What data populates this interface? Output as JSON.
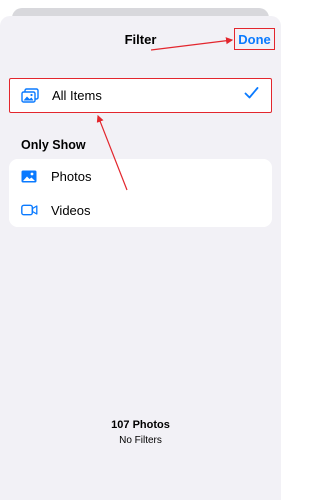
{
  "header": {
    "title": "Filter",
    "done_label": "Done"
  },
  "options": {
    "all_items": {
      "label": "All Items",
      "selected": true
    }
  },
  "only_show": {
    "header": "Only Show",
    "items": [
      {
        "label": "Photos",
        "icon": "photo-icon"
      },
      {
        "label": "Videos",
        "icon": "video-icon"
      }
    ]
  },
  "footer": {
    "count": "107 Photos",
    "filter_status": "No Filters"
  },
  "colors": {
    "accent": "#0a7aff",
    "annotation": "#e3262d",
    "background": "#f2f1f6"
  }
}
